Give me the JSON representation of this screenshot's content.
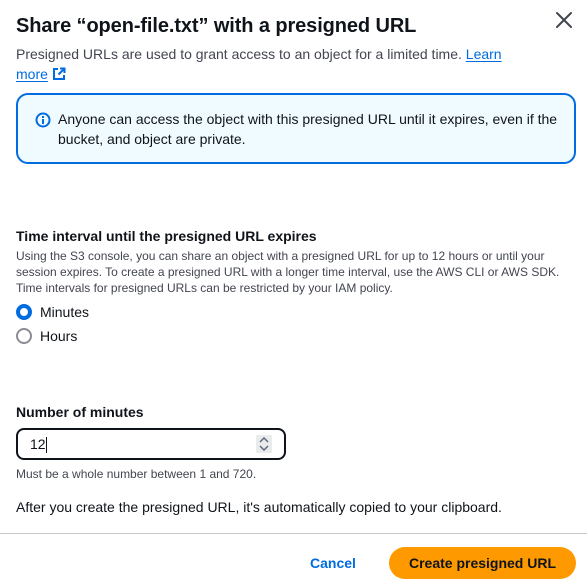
{
  "modal": {
    "title": "Share “open-file.txt” with a presigned URL",
    "subtitle": "Presigned URLs are used to grant access to an object for a limited time.",
    "learn_more_link": "Learn more",
    "close_icon": "close-icon"
  },
  "alert": {
    "icon": "info-icon",
    "text": "Anyone can access the object with this presigned URL until it expires, even if the bucket, and object are private."
  },
  "time_interval": {
    "label": "Time interval until the presigned URL expires",
    "description": "Using the S3 console, you can share an object with a presigned URL for up to 12 hours or until your session expires. To create a presigned URL with a longer time interval, use the AWS CLI or AWS SDK. Time intervals for presigned URLs can be restricted by your IAM policy.",
    "options": [
      {
        "label": "Minutes",
        "selected": true
      },
      {
        "label": "Hours",
        "selected": false
      }
    ]
  },
  "minutes": {
    "label": "Number of minutes",
    "value": "12",
    "hint": "Must be a whole number between 1 and 720."
  },
  "clipboard_note": "After you create the presigned URL, it's automatically copied to your clipboard.",
  "footer": {
    "cancel_label": "Cancel",
    "create_label": "Create presigned URL"
  },
  "colors": {
    "accent": "#006ce0",
    "primary_button": "#ff9900",
    "alert_background": "#f0fbff"
  }
}
